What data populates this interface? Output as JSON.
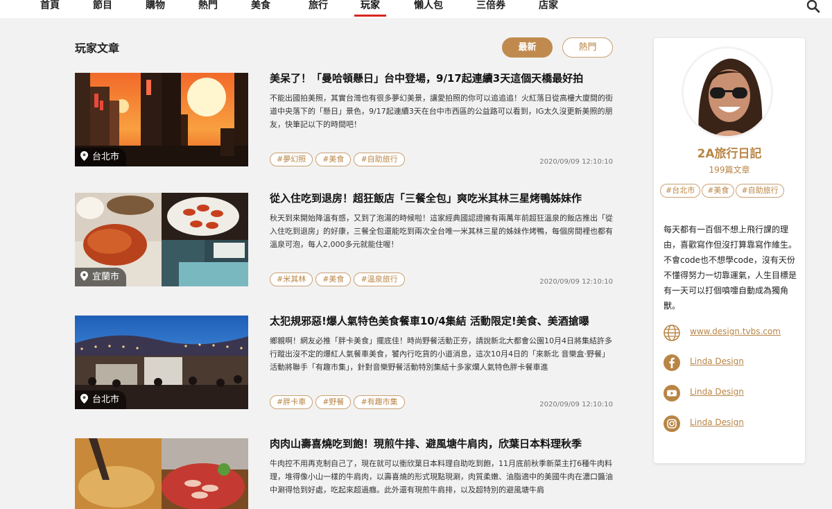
{
  "nav": {
    "items": [
      {
        "label": "首頁"
      },
      {
        "label": "節目"
      },
      {
        "label": "購物"
      },
      {
        "label": "熱門"
      },
      {
        "label": "美食"
      },
      {
        "label": "旅行"
      },
      {
        "label": "玩家",
        "active": true
      },
      {
        "label": "懶人包"
      },
      {
        "label": "三倍券"
      },
      {
        "label": "店家"
      }
    ],
    "search_icon": "search-icon"
  },
  "main": {
    "section_title": "玩家文章",
    "sort": {
      "latest": "最新",
      "hot": "熱門",
      "selected": "最新"
    },
    "articles": [
      {
        "title": "美呆了！「曼哈頓懸日」台中登場，9/17起連續3天這個天橋最好拍",
        "summary": "不能出國拍美照，其實台灣也有很多夢幻美景，讓愛拍照的你可以追追追！火紅落日從高樓大廈間的街道中央落下的「懸日」景色，9/17起連續3天在台中市西區的公益路可以看到，IG太久沒更新美照的朋友，快筆記以下的時間吧！",
        "location": "台北市",
        "tags": [
          "#夢幻照",
          "#美食",
          "#自助旅行"
        ],
        "date": "2020/09/09 12:10:10"
      },
      {
        "title": "從入住吃到退房！超狂飯店「三餐全包」爽吃米其林三星烤鴨姊妹作",
        "summary": "秋天到來開始降溫有感，又到了泡湯的時候啦！這家經典國認證擁有兩萬年前超狂溫泉的飯店推出「從入住吃到退房」的好康，三餐全包還能吃到兩次全台唯一米其林三星的姊妹作烤鴨，每個房間裡也都有溫泉可泡，每人2,000多元就能住喔！",
        "location": "宜蘭市",
        "tags": [
          "#米其林",
          "#美食",
          "#溫泉旅行"
        ],
        "date": "2020/09/09 12:10:10"
      },
      {
        "title": "太犯規邪惡!爆人氣特色美食餐車10/4集結 活動限定!美食、美酒搶曝",
        "summary": "鄉親啊！網友必推「胖卡美食」擺底佳！時尚野餐活動正夯，請說新北大都會公園10月4日將集結許多行蹤出沒不定的爆紅人氣餐車美食，饕內行吃貨的小道消息，這次10月4日的「來新北 音樂盒‧野餐」活動將聯手「有趣市集」，針對音樂野餐活動特別集結十多家爛人氣特色胖卡餐車進",
        "location": "台北市",
        "tags": [
          "#胖卡車",
          "#野餐",
          "#有趣市集"
        ],
        "date": "2020/09/09 12:10:10"
      },
      {
        "title": "肉肉山壽喜燒吃到飽！現煎牛排、避風塘牛肩肉，欣葉日本料理秋季",
        "summary": "牛肉控不用再克制自己了，現在就可以衝欣葉日本料理自助吃到飽，11月底前秋季新菜主打6種牛肉料理，堆得像小山一樣的牛肩肉，以壽喜燒的形式現點現涮，肉質柔嫩、油脂適中的美國牛肉在濃口醬油中涮得恰到好處，吃起來超過癮。此外還有現煎牛肩排，以及超特別的避風塘牛肩",
        "location": "",
        "tags": [],
        "date": ""
      }
    ]
  },
  "sidebar": {
    "author_name": "2A旅行日記",
    "article_count": "199篇文章",
    "tags": [
      "#台北市",
      "#美食",
      "#自助旅行"
    ],
    "bio": "每天都有一百個不想上飛行課的理由，喜歡寫作但沒打算靠寫作維生。不會code也不想學code，沒有天份不懂得努力一切靠運氣，人生目標是有一天可以打個噴嚏自動成為獨角獸。",
    "links": [
      {
        "icon": "globe-icon",
        "label": "www.design.tvbs.com"
      },
      {
        "icon": "facebook-icon",
        "label": "Linda Design"
      },
      {
        "icon": "youtube-icon",
        "label": "Linda Design"
      },
      {
        "icon": "instagram-icon",
        "label": "Linda Design"
      }
    ]
  },
  "colors": {
    "accent": "#c08a4f",
    "accent_text": "#b98545",
    "nav_active_underline": "#d8251d",
    "background": "#f2f2f2"
  }
}
